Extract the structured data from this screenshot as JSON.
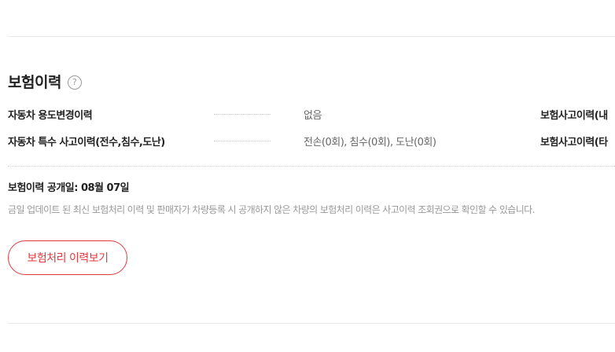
{
  "section": {
    "title": "보험이력",
    "help_icon": "question-mark-circle-icon",
    "help_glyph": "?"
  },
  "rows": [
    {
      "label": "자동차 용도변경이력",
      "value": "없음",
      "right_label": "보험사고이력(내"
    },
    {
      "label": "자동차 특수 사고이력(전수,침수,도난)",
      "value": "전손(0회), 침수(0회), 도난(0회)",
      "right_label": "보험사고이력(타"
    }
  ],
  "release": {
    "text": "보험이력 공개일: 08월 07일"
  },
  "notice": {
    "text": "금일 업데이트 된 최신 보험처리 이력 및 판매자가 차량등록 시 공개하지 않은 차량의 보험처리 이력은 사고이력 조회권으로 확인할 수 있습니다."
  },
  "action": {
    "button_label": "보험처리 이력보기"
  },
  "colors": {
    "accent": "#e03a3e",
    "text_primary": "#222222",
    "text_secondary": "#666666",
    "text_muted": "#999999",
    "divider": "#e8e8e8"
  }
}
